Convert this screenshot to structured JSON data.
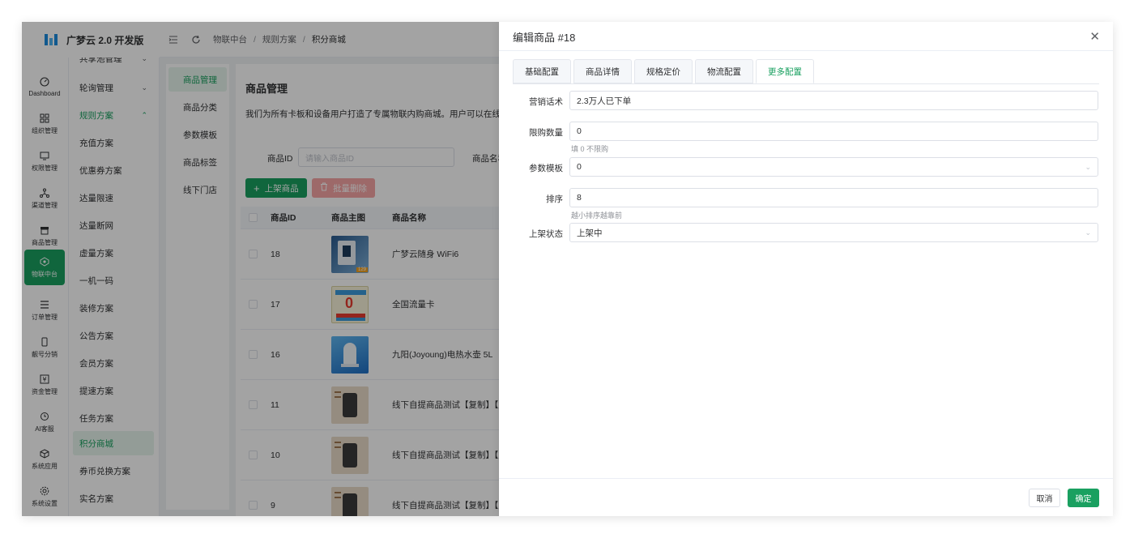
{
  "app": {
    "name": "广梦云 2.0 开发版"
  },
  "rail": [
    {
      "label": "Dashboard",
      "icon": "dashboard-icon"
    },
    {
      "label": "组织管理",
      "icon": "grid-icon"
    },
    {
      "label": "权限管理",
      "icon": "monitor-icon"
    },
    {
      "label": "渠道管理",
      "icon": "network-icon"
    },
    {
      "label": "商品管理",
      "icon": "store-icon"
    },
    {
      "label": "物联中台",
      "icon": "iot-icon",
      "active": true
    },
    {
      "label": "订单管理",
      "icon": "list-icon"
    },
    {
      "label": "靓号分销",
      "icon": "phone-icon"
    },
    {
      "label": "资金管理",
      "icon": "money-icon"
    },
    {
      "label": "AI客服",
      "icon": "ai-icon"
    },
    {
      "label": "系统应用",
      "icon": "app-icon"
    },
    {
      "label": "系统设置",
      "icon": "settings-icon"
    }
  ],
  "submenu": [
    {
      "label": "共享池管理"
    },
    {
      "label": "轮询管理"
    },
    {
      "label": "规则方案"
    },
    {
      "label": "充值方案"
    },
    {
      "label": "优惠券方案"
    },
    {
      "label": "达量限速"
    },
    {
      "label": "达量断网"
    },
    {
      "label": "虚量方案"
    },
    {
      "label": "一机一码"
    },
    {
      "label": "装修方案"
    },
    {
      "label": "公告方案"
    },
    {
      "label": "会员方案"
    },
    {
      "label": "提速方案"
    },
    {
      "label": "任务方案"
    },
    {
      "label": "积分商城"
    },
    {
      "label": "券币兑换方案"
    },
    {
      "label": "实名方案"
    }
  ],
  "breadcrumb": [
    "物联中台",
    "规则方案",
    "积分商城"
  ],
  "side_tabs": [
    "商品管理",
    "商品分类",
    "参数模板",
    "商品标签",
    "线下门店"
  ],
  "main": {
    "title": "商品管理",
    "description": "我们为所有卡板和设备用户打造了专属物联内购商城。用户可以在线支付",
    "filter_id_label": "商品ID",
    "filter_id_placeholder": "请输入商品ID",
    "filter_name_label": "商品名称",
    "btn_add": "上架商品",
    "btn_batch_delete": "批量删除"
  },
  "table": {
    "headers": [
      "商品ID",
      "商品主图",
      "商品名称"
    ],
    "rows": [
      {
        "id": "18",
        "name": "广梦云随身 WiFi6",
        "thumb_text": "129"
      },
      {
        "id": "17",
        "name": "全国流量卡",
        "thumb_text": "0"
      },
      {
        "id": "16",
        "name": "九阳(Joyoung)电热水壶 5L",
        "thumb_text": ""
      },
      {
        "id": "11",
        "name": "线下自提商品测试【复制】【复",
        "thumb_text": ""
      },
      {
        "id": "10",
        "name": "线下自提商品测试【复制】【复",
        "thumb_text": ""
      },
      {
        "id": "9",
        "name": "线下自提商品测试【复制】【复",
        "thumb_text": ""
      }
    ]
  },
  "drawer": {
    "title": "编辑商品 #18",
    "tabs": [
      "基础配置",
      "商品详情",
      "规格定价",
      "物流配置",
      "更多配置"
    ],
    "active_tab": "更多配置",
    "fields": {
      "marketing_label": "营销话术",
      "marketing_value": "2.3万人已下单",
      "limit_label": "限购数量",
      "limit_value": "0",
      "limit_hint": "填 0 不限购",
      "template_label": "参数模板",
      "template_value": "0",
      "sort_label": "排序",
      "sort_value": "8",
      "sort_hint": "越小排序越靠前",
      "status_label": "上架状态",
      "status_value": "上架中"
    },
    "cancel": "取消",
    "confirm": "确定"
  },
  "colors": {
    "accent": "#1aa060",
    "danger_light": "#f6a4a4",
    "brand": "#1b8cde"
  }
}
